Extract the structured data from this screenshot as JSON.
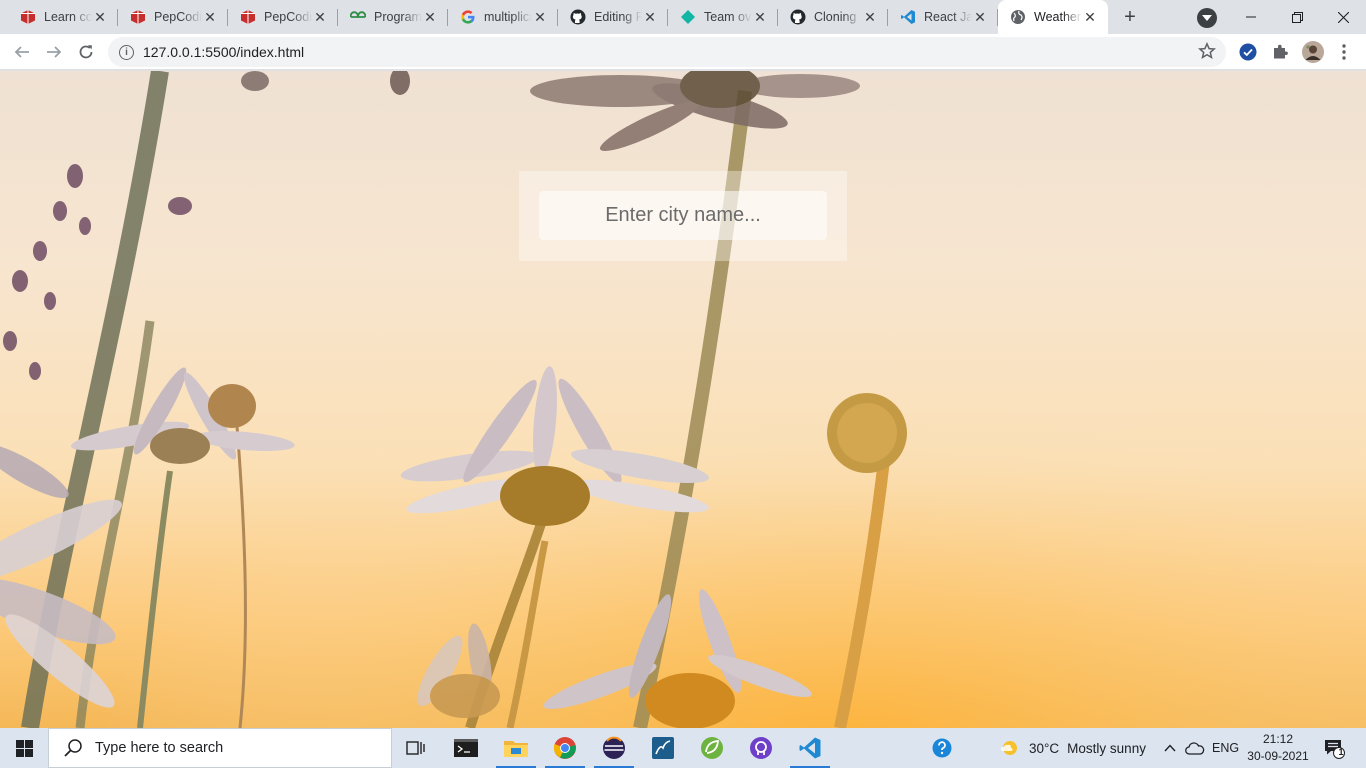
{
  "browser": {
    "tabs": [
      {
        "title": "Learn coding",
        "favicon": "pepcoding-icon",
        "active": false
      },
      {
        "title": "PepCoding",
        "favicon": "pepcoding-icon",
        "active": false
      },
      {
        "title": "PepCoding",
        "favicon": "pepcoding-icon",
        "active": false
      },
      {
        "title": "Programming",
        "favicon": "geeksforgeeks-icon",
        "active": false
      },
      {
        "title": "multiplication",
        "favicon": "google-icon",
        "active": false
      },
      {
        "title": "Editing README",
        "favicon": "github-icon",
        "active": false
      },
      {
        "title": "Team overview",
        "favicon": "diamond-icon",
        "active": false
      },
      {
        "title": "Cloning",
        "favicon": "github-icon",
        "active": false
      },
      {
        "title": "React Java",
        "favicon": "vscode-icon",
        "active": false
      },
      {
        "title": "Weather",
        "favicon": "globe-icon",
        "active": true
      }
    ],
    "tab_close_glyph": "✕",
    "new_tab_glyph": "+",
    "url": "127.0.0.1:5500/index.html"
  },
  "page": {
    "search": {
      "placeholder": "Enter city name...",
      "value": ""
    }
  },
  "taskbar": {
    "search_placeholder": "Type here to search",
    "pinned": [
      "task-view-icon",
      "terminal-icon",
      "file-explorer-icon",
      "chrome-icon",
      "eclipse-icon",
      "mysql-workbench-icon",
      "spring-tools-icon",
      "github-desktop-icon",
      "vscode-icon"
    ],
    "weather": {
      "temperature": "30°C",
      "condition": "Mostly sunny"
    },
    "language": "ENG",
    "time": "21:12",
    "date": "30-09-2021",
    "notification_count": "1"
  },
  "colors": {
    "accent": "#1a73e8",
    "taskbar": "#dce4ef",
    "sky_top": "#efe1d3",
    "sky_bottom": "#f5b858"
  }
}
